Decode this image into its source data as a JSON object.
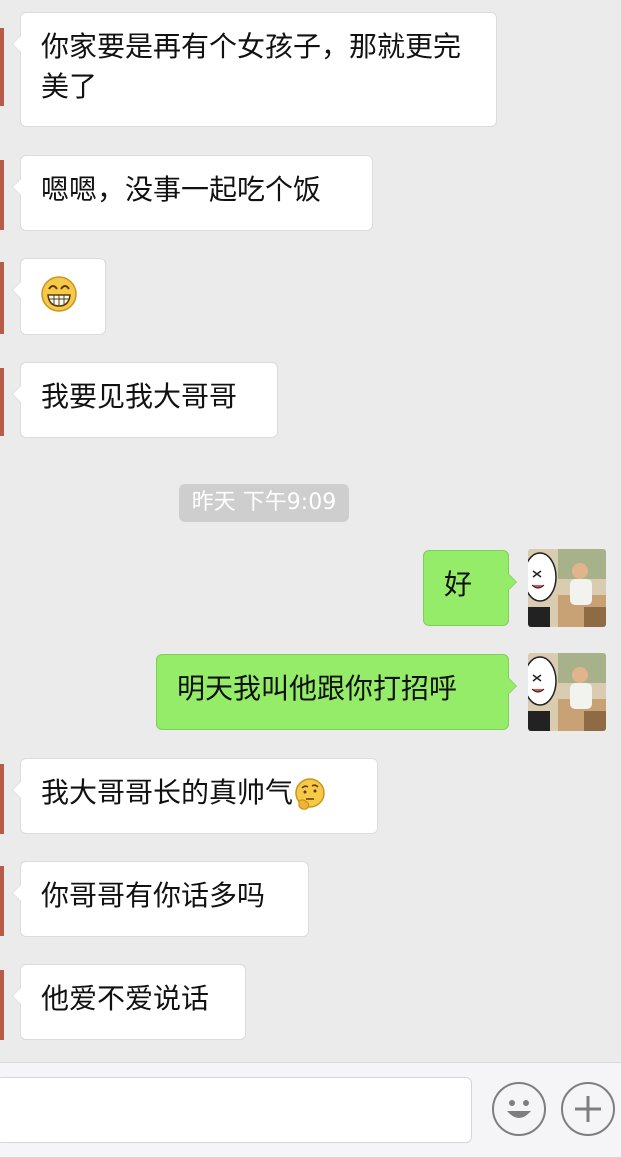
{
  "messages": [
    {
      "side": "in",
      "text": "你家要是再有个女孩子，那就更完美了"
    },
    {
      "side": "in",
      "text": "嗯嗯，没事一起吃个饭"
    },
    {
      "side": "in",
      "emoji": "grinning-face-emoji"
    },
    {
      "side": "in",
      "text": "我要见我大哥哥"
    },
    {
      "side": "out",
      "text": "好"
    },
    {
      "side": "out",
      "text": "明天我叫他跟你打招呼"
    },
    {
      "side": "in",
      "text": "我大哥哥长的真帅气",
      "emoji": "thinking-face-emoji"
    },
    {
      "side": "in",
      "text": "你哥哥有你话多吗"
    },
    {
      "side": "in",
      "text": "他爱不爱说话"
    }
  ],
  "timestamp": "昨天 下午9:09",
  "input": {
    "value": "",
    "placeholder": ""
  },
  "toolbar": {
    "emoji_button_icon": "smiley-face-icon",
    "more_button_icon": "plus-icon"
  },
  "colors": {
    "background": "#ebebeb",
    "incoming_bubble": "#ffffff",
    "outgoing_bubble": "#95ec69",
    "timestamp_pill": "#cecece"
  }
}
